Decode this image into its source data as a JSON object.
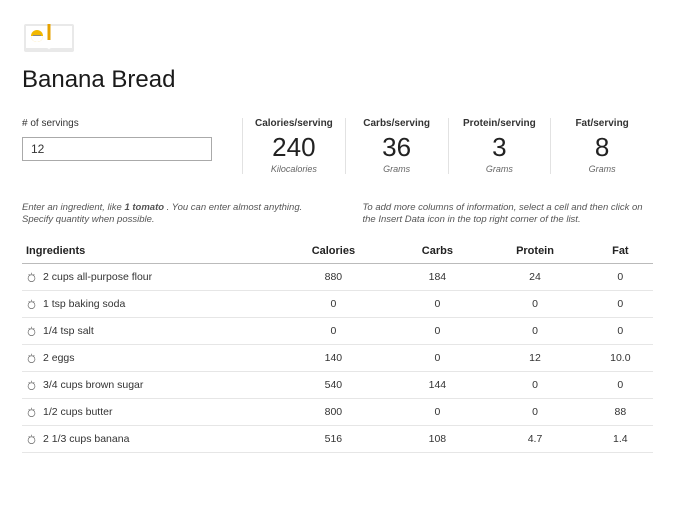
{
  "title": "Banana Bread",
  "servings": {
    "label": "# of servings",
    "value": "12"
  },
  "stats": [
    {
      "label": "Calories/serving",
      "value": "240",
      "unit": "Kilocalories"
    },
    {
      "label": "Carbs/serving",
      "value": "36",
      "unit": "Grams"
    },
    {
      "label": "Protein/serving",
      "value": "3",
      "unit": "Grams"
    },
    {
      "label": "Fat/serving",
      "value": "8",
      "unit": "Grams"
    }
  ],
  "hints": {
    "left_pre": "Enter an ingredient, like ",
    "left_bold": "1 tomato",
    "left_post": " . You can enter almost anything. Specify quantity when possible.",
    "right": "To add more columns of information, select a cell and then click on the Insert Data icon in the top right corner of the list."
  },
  "table": {
    "headers": [
      "Ingredients",
      "Calories",
      "Carbs",
      "Protein",
      "Fat"
    ],
    "rows": [
      {
        "name": "2 cups all-purpose flour",
        "cal": "880",
        "carb": "184",
        "prot": "24",
        "fat": "0"
      },
      {
        "name": "1 tsp baking soda",
        "cal": "0",
        "carb": "0",
        "prot": "0",
        "fat": "0"
      },
      {
        "name": "1/4 tsp salt",
        "cal": "0",
        "carb": "0",
        "prot": "0",
        "fat": "0"
      },
      {
        "name": "2 eggs",
        "cal": "140",
        "carb": "0",
        "prot": "12",
        "fat": "10.0"
      },
      {
        "name": "3/4 cups brown sugar",
        "cal": "540",
        "carb": "144",
        "prot": "0",
        "fat": "0"
      },
      {
        "name": "1/2 cups butter",
        "cal": "800",
        "carb": "0",
        "prot": "0",
        "fat": "88"
      },
      {
        "name": "2 1/3 cups banana",
        "cal": "516",
        "carb": "108",
        "prot": "4.7",
        "fat": "1.4"
      }
    ]
  }
}
